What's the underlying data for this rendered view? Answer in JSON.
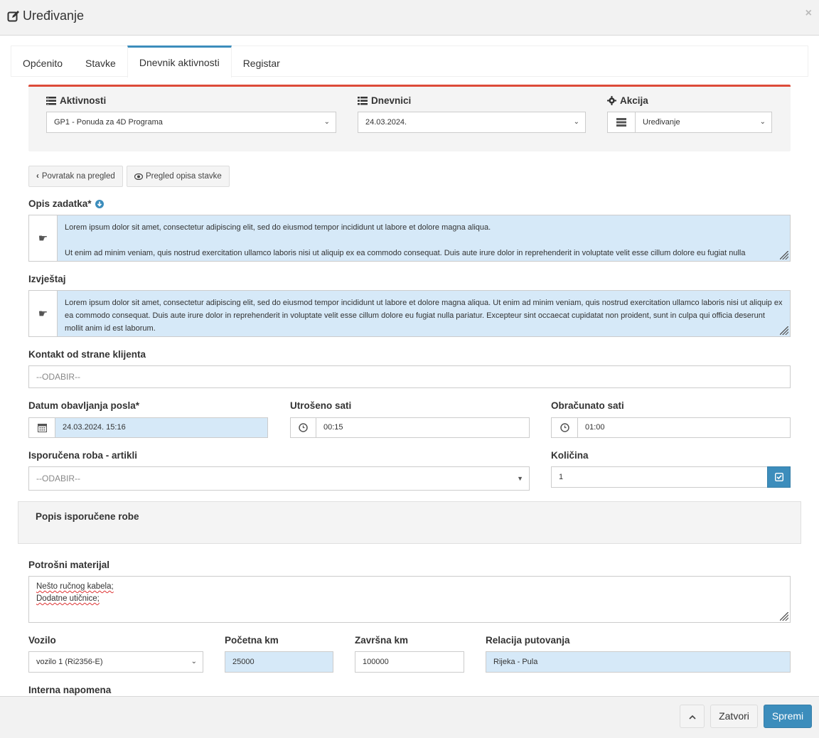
{
  "modal": {
    "title": "Uređivanje",
    "close": "×"
  },
  "tabs": [
    "Općenito",
    "Stavke",
    "Dnevnik aktivnosti",
    "Registar"
  ],
  "top": {
    "aktivnosti_label": "Aktivnosti",
    "aktivnosti_value": "GP1 - Ponuda za 4D Programa",
    "dnevnici_label": "Dnevnici",
    "dnevnici_value": "24.03.2024.",
    "akcija_label": "Akcija",
    "akcija_value": "Uređivanje"
  },
  "buttons": {
    "back": "Povratak na pregled",
    "preview": "Pregled opisa stavke"
  },
  "opis": {
    "label": "Opis zadatka*",
    "line1": "Lorem ipsum dolor sit amet, consectetur adipiscing elit, sed do eiusmod tempor incididunt ut labore et dolore magna aliqua.",
    "line2": "Ut enim ad minim veniam, quis nostrud exercitation ullamco laboris nisi ut aliquip ex ea commodo consequat. Duis aute irure dolor in reprehenderit in voluptate velit esse cillum dolore eu fugiat nulla"
  },
  "izvjestaj": {
    "label": "Izvještaj",
    "text": "Lorem ipsum dolor sit amet, consectetur adipiscing elit, sed do eiusmod tempor incididunt ut labore et dolore magna aliqua. Ut enim ad minim veniam, quis nostrud exercitation ullamco laboris nisi ut aliquip ex ea commodo consequat. Duis aute irure dolor in reprehenderit in voluptate velit esse cillum dolore eu fugiat nulla pariatur. Excepteur sint occaecat cupidatat non proident, sunt in culpa qui officia deserunt mollit anim id est laborum."
  },
  "kontakt": {
    "label": "Kontakt od strane klijenta",
    "placeholder": "--ODABIR--"
  },
  "datum": {
    "label": "Datum obavljanja posla*",
    "value": "24.03.2024. 15:16"
  },
  "utroseno": {
    "label": "Utrošeno sati",
    "value": "00:15"
  },
  "obracunato": {
    "label": "Obračunato sati",
    "value": "01:00"
  },
  "isporucena": {
    "label": "Isporučena roba - artikli",
    "placeholder": "--ODABIR--"
  },
  "kolicina": {
    "label": "Količina",
    "value": "1"
  },
  "popis": {
    "title": "Popis isporučene robe"
  },
  "potrosni": {
    "label": "Potrošni materijal",
    "line1": "Nešto ručnog kabela;",
    "line2": "Dodatne utičnice;"
  },
  "vozilo": {
    "label": "Vozilo",
    "value": "vozilo 1 (Ri2356-E)"
  },
  "pocetna": {
    "label": "Početna km",
    "value": "25000"
  },
  "zavrsna": {
    "label": "Završna km",
    "value": "100000"
  },
  "relacija": {
    "label": "Relacija putovanja",
    "value": "Rijeka - Pula"
  },
  "interna": {
    "label": "Interna napomena"
  },
  "footer": {
    "zatvori": "Zatvori",
    "spremi": "Spremi"
  },
  "colors": {
    "primary": "#3c8dbc",
    "danger_top": "#dd4b39",
    "field_blue": "#d6e9f8"
  }
}
